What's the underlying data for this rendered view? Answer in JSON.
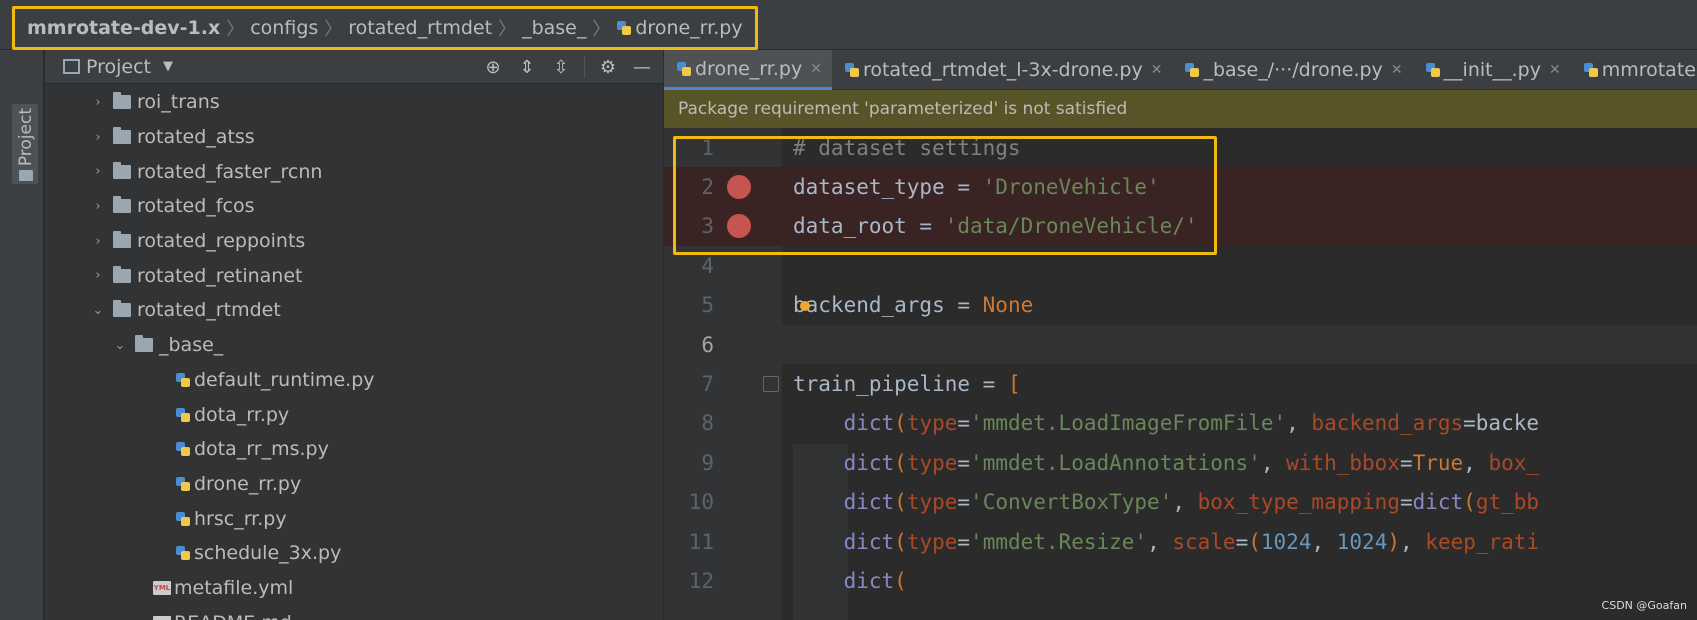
{
  "breadcrumb": {
    "items": [
      "mmrotate-dev-1.x",
      "configs",
      "rotated_rtmdet",
      "_base_",
      "drone_rr.py"
    ],
    "separator": "〉"
  },
  "tool_strip": {
    "label": "Project"
  },
  "project_panel": {
    "title": "Project",
    "tree": [
      {
        "label": "roi_trans",
        "kind": "folder",
        "expanded": false,
        "depth": 0
      },
      {
        "label": "rotated_atss",
        "kind": "folder",
        "expanded": false,
        "depth": 0
      },
      {
        "label": "rotated_faster_rcnn",
        "kind": "folder",
        "expanded": false,
        "depth": 0
      },
      {
        "label": "rotated_fcos",
        "kind": "folder",
        "expanded": false,
        "depth": 0
      },
      {
        "label": "rotated_reppoints",
        "kind": "folder",
        "expanded": false,
        "depth": 0
      },
      {
        "label": "rotated_retinanet",
        "kind": "folder",
        "expanded": false,
        "depth": 0
      },
      {
        "label": "rotated_rtmdet",
        "kind": "folder",
        "expanded": true,
        "depth": 0
      },
      {
        "label": "_base_",
        "kind": "folder",
        "expanded": true,
        "depth": 1
      },
      {
        "label": "default_runtime.py",
        "kind": "py",
        "depth": 2
      },
      {
        "label": "dota_rr.py",
        "kind": "py",
        "depth": 2
      },
      {
        "label": "dota_rr_ms.py",
        "kind": "py",
        "depth": 2
      },
      {
        "label": "drone_rr.py",
        "kind": "py",
        "depth": 2
      },
      {
        "label": "hrsc_rr.py",
        "kind": "py",
        "depth": 2
      },
      {
        "label": "schedule_3x.py",
        "kind": "py",
        "depth": 2
      },
      {
        "label": "metafile.yml",
        "kind": "yml",
        "depth": 1
      },
      {
        "label": "README.md",
        "kind": "md",
        "depth": 1
      }
    ]
  },
  "editor": {
    "tabs": [
      {
        "label": "drone_rr.py",
        "active": true
      },
      {
        "label": "rotated_rtmdet_l-3x-drone.py",
        "active": false
      },
      {
        "label": "_base_/···/drone.py",
        "active": false
      },
      {
        "label": "__init__.py",
        "active": false
      },
      {
        "label": "mmrotate",
        "active": false
      }
    ],
    "notice": "Package requirement 'parameterized' is not satisfied",
    "lines": [
      {
        "num": "1",
        "tokens": [
          [
            "c-comment",
            "# dataset settings"
          ]
        ]
      },
      {
        "num": "2",
        "breakpoint": true,
        "tokens": [
          [
            "c-plain",
            "dataset_type = "
          ],
          [
            "c-str",
            "'DroneVehicle'"
          ]
        ]
      },
      {
        "num": "3",
        "breakpoint": true,
        "tokens": [
          [
            "c-plain",
            "data_root = "
          ],
          [
            "c-str",
            "'data/DroneVehicle/'"
          ]
        ]
      },
      {
        "num": "4",
        "tokens": []
      },
      {
        "num": "5",
        "bulb": true,
        "tokens": [
          [
            "c-plain",
            "backend_args = "
          ],
          [
            "c-kw",
            "None"
          ]
        ]
      },
      {
        "num": "6",
        "current": true,
        "tokens": []
      },
      {
        "num": "7",
        "fold": true,
        "tokens": [
          [
            "c-plain",
            "train_pipeline = "
          ],
          [
            "c-kw",
            "["
          ]
        ]
      },
      {
        "num": "8",
        "tokens": [
          [
            "c-plain",
            "    "
          ],
          [
            "c-fn",
            "dict"
          ],
          [
            "c-kw",
            "("
          ],
          [
            "c-param",
            "type"
          ],
          [
            "c-plain",
            "="
          ],
          [
            "c-str",
            "'mmdet.LoadImageFromFile'"
          ],
          [
            "c-plain",
            ", "
          ],
          [
            "c-param",
            "backend_args"
          ],
          [
            "c-plain",
            "=backe"
          ]
        ]
      },
      {
        "num": "9",
        "tokens": [
          [
            "c-plain",
            "    "
          ],
          [
            "c-fn",
            "dict"
          ],
          [
            "c-kw",
            "("
          ],
          [
            "c-param",
            "type"
          ],
          [
            "c-plain",
            "="
          ],
          [
            "c-str",
            "'mmdet.LoadAnnotations'"
          ],
          [
            "c-plain",
            ", "
          ],
          [
            "c-param",
            "with_bbox"
          ],
          [
            "c-plain",
            "="
          ],
          [
            "c-kw",
            "True"
          ],
          [
            "c-plain",
            ", "
          ],
          [
            "c-param",
            "box_"
          ]
        ]
      },
      {
        "num": "10",
        "tokens": [
          [
            "c-plain",
            "    "
          ],
          [
            "c-fn",
            "dict"
          ],
          [
            "c-kw",
            "("
          ],
          [
            "c-param",
            "type"
          ],
          [
            "c-plain",
            "="
          ],
          [
            "c-str",
            "'ConvertBoxType'"
          ],
          [
            "c-plain",
            ", "
          ],
          [
            "c-param",
            "box_type_mapping"
          ],
          [
            "c-plain",
            "="
          ],
          [
            "c-fn",
            "dict"
          ],
          [
            "c-kw",
            "("
          ],
          [
            "c-param",
            "gt_bb"
          ]
        ]
      },
      {
        "num": "11",
        "tokens": [
          [
            "c-plain",
            "    "
          ],
          [
            "c-fn",
            "dict"
          ],
          [
            "c-kw",
            "("
          ],
          [
            "c-param",
            "type"
          ],
          [
            "c-plain",
            "="
          ],
          [
            "c-str",
            "'mmdet.Resize'"
          ],
          [
            "c-plain",
            ", "
          ],
          [
            "c-param",
            "scale"
          ],
          [
            "c-plain",
            "="
          ],
          [
            "c-kw",
            "("
          ],
          [
            "c-num",
            "1024"
          ],
          [
            "c-plain",
            ", "
          ],
          [
            "c-num",
            "1024"
          ],
          [
            "c-kw",
            ")"
          ],
          [
            "c-plain",
            ", "
          ],
          [
            "c-param",
            "keep_rati"
          ]
        ]
      },
      {
        "num": "12",
        "tokens": [
          [
            "c-plain",
            "    "
          ],
          [
            "c-fn",
            "dict"
          ],
          [
            "c-kw",
            "("
          ]
        ]
      }
    ]
  },
  "watermark": "CSDN @Goafan"
}
